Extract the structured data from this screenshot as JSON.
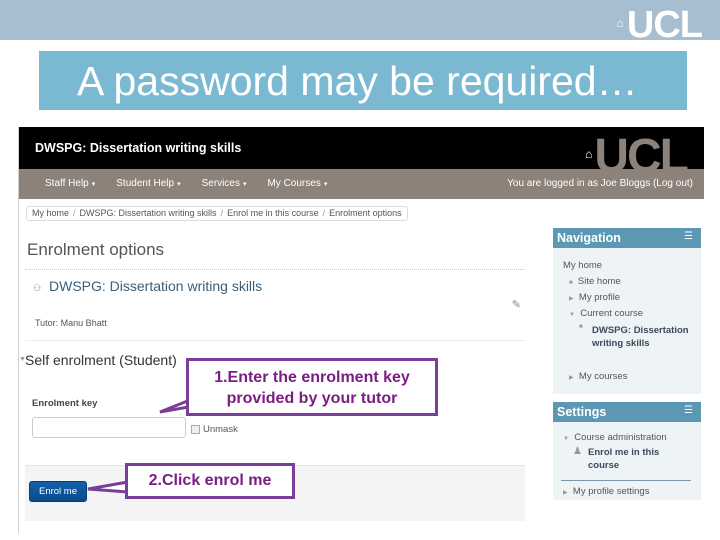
{
  "slide": {
    "title": "A password may be required…",
    "logo_text": "UCL",
    "logo_mark": "⌂"
  },
  "site": {
    "course_title": "DWSPG: Dissertation writing skills",
    "logo_text": "UCL",
    "logo_mark": "⌂",
    "menu": [
      {
        "label": "Staff Help"
      },
      {
        "label": "Student Help"
      },
      {
        "label": "Services"
      },
      {
        "label": "My Courses"
      }
    ],
    "caret": "▾",
    "login_text": "You are logged in as Joe Bloggs (Log out)"
  },
  "breadcrumb": {
    "items": [
      "My home",
      "DWSPG: Dissertation writing skills",
      "Enrol me in this course",
      "Enrolment options"
    ],
    "separator": "/"
  },
  "main": {
    "heading": "Enrolment options",
    "course_icon": "⚇",
    "course_name": "DWSPG: Dissertation writing skills",
    "edit_icon": "✎",
    "tutor": "Tutor: Manu Bhatt",
    "self_enrolment": {
      "collapse_icon": "▼",
      "heading": "Self enrolment (Student)",
      "key_label": "Enrolment key",
      "key_value": "",
      "unmask_label": "Unmask",
      "unmask_checked": false,
      "enrol_button": "Enrol me"
    }
  },
  "navigation": {
    "title": "Navigation",
    "dock_icon": "☰",
    "items": [
      {
        "label": "My home",
        "bullet": ""
      },
      {
        "label": "Site home",
        "bullet": "■"
      },
      {
        "label": "My profile",
        "bullet": "▶"
      },
      {
        "label": "Current course",
        "bullet": "▼"
      },
      {
        "label": "DWSPG: Dissertation writing skills",
        "bullet": "■"
      },
      {
        "label": "My courses",
        "bullet": "▶"
      }
    ]
  },
  "settings": {
    "title": "Settings",
    "dock_icon": "☰",
    "items": [
      {
        "label": "Course administration",
        "bullet": "▼"
      },
      {
        "label": "Enrol me in this course",
        "bullet": "♟"
      },
      {
        "label": "My profile settings",
        "bullet": "▶"
      }
    ]
  },
  "callouts": {
    "step1": "1.Enter the enrolment key provided by your tutor",
    "step2": "2.Click enrol me",
    "color": "#7a3e98"
  }
}
